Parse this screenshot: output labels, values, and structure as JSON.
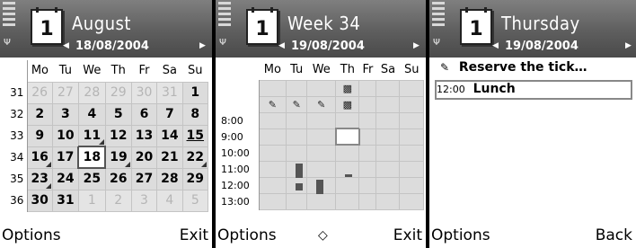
{
  "month": {
    "title": "August",
    "date": "18/08/2004",
    "icon_day": "1",
    "weekdays": [
      "Mo",
      "Tu",
      "We",
      "Th",
      "Fr",
      "Sa",
      "Su"
    ],
    "rows": [
      {
        "wk": "31",
        "days": [
          {
            "n": "26",
            "o": 1
          },
          {
            "n": "27",
            "o": 1
          },
          {
            "n": "28",
            "o": 1
          },
          {
            "n": "29",
            "o": 1
          },
          {
            "n": "30",
            "o": 1
          },
          {
            "n": "31",
            "o": 1
          },
          {
            "n": "1"
          }
        ]
      },
      {
        "wk": "32",
        "days": [
          {
            "n": "2"
          },
          {
            "n": "3"
          },
          {
            "n": "4"
          },
          {
            "n": "5"
          },
          {
            "n": "6"
          },
          {
            "n": "7"
          },
          {
            "n": "8"
          }
        ]
      },
      {
        "wk": "33",
        "days": [
          {
            "n": "9"
          },
          {
            "n": "10"
          },
          {
            "n": "11",
            "m": 1
          },
          {
            "n": "12"
          },
          {
            "n": "13"
          },
          {
            "n": "14"
          },
          {
            "n": "15",
            "u": 1
          }
        ]
      },
      {
        "wk": "34",
        "days": [
          {
            "n": "16",
            "m": 1
          },
          {
            "n": "17"
          },
          {
            "n": "18",
            "t": 1
          },
          {
            "n": "19",
            "m": 1
          },
          {
            "n": "20"
          },
          {
            "n": "21"
          },
          {
            "n": "22",
            "m": 1
          }
        ]
      },
      {
        "wk": "35",
        "days": [
          {
            "n": "23",
            "m": 1
          },
          {
            "n": "24"
          },
          {
            "n": "25"
          },
          {
            "n": "26"
          },
          {
            "n": "27"
          },
          {
            "n": "28"
          },
          {
            "n": "29"
          }
        ]
      },
      {
        "wk": "36",
        "days": [
          {
            "n": "30"
          },
          {
            "n": "31"
          },
          {
            "n": "1",
            "o": 1
          },
          {
            "n": "2",
            "o": 1
          },
          {
            "n": "3",
            "o": 1
          },
          {
            "n": "4",
            "o": 1
          },
          {
            "n": "5",
            "o": 1
          }
        ]
      }
    ],
    "softkey_left": "Options",
    "softkey_right": "Exit"
  },
  "week": {
    "title": "Week 34",
    "date": "19/08/2004",
    "icon_day": "1",
    "weekdays": [
      "Mo",
      "Tu",
      "We",
      "Th",
      "Fr",
      "Sa",
      "Su"
    ],
    "times": [
      "8:00",
      "9:00",
      "10:00",
      "11:00",
      "12:00",
      "13:00"
    ],
    "softkey_left": "Options",
    "softkey_middle": "◇",
    "softkey_right": "Exit"
  },
  "day": {
    "title": "Thursday",
    "date": "19/08/2004",
    "icon_day": "1",
    "entries": [
      {
        "time": "",
        "icon": "memo-icon",
        "text": "Reserve the tick…"
      },
      {
        "time": "12:00",
        "icon": "",
        "text": "Lunch"
      }
    ],
    "softkey_left": "Options",
    "softkey_right": "Back"
  },
  "colors": {
    "header": "#5e5e5e",
    "cell": "#dcdcdc",
    "other_month": "#b5b5b5"
  }
}
